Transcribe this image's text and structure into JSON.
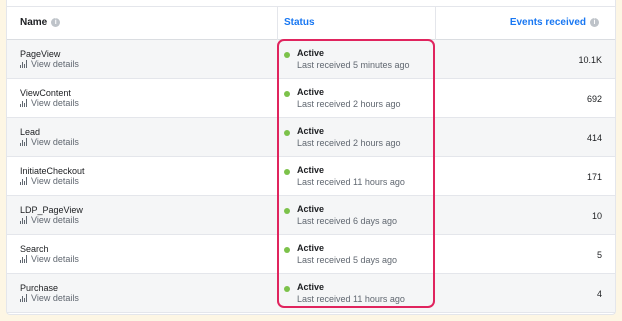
{
  "header": {
    "name_label": "Name",
    "status_label": "Status",
    "events_label": "Events received"
  },
  "rows": [
    {
      "name": "PageView",
      "details": "View details",
      "status": "Active",
      "last": "Last received 5 minutes ago",
      "count": "10.1K"
    },
    {
      "name": "ViewContent",
      "details": "View details",
      "status": "Active",
      "last": "Last received 2 hours ago",
      "count": "692"
    },
    {
      "name": "Lead",
      "details": "View details",
      "status": "Active",
      "last": "Last received 2 hours ago",
      "count": "414"
    },
    {
      "name": "InitiateCheckout",
      "details": "View details",
      "status": "Active",
      "last": "Last received 11 hours ago",
      "count": "171"
    },
    {
      "name": "LDP_PageView",
      "details": "View details",
      "status": "Active",
      "last": "Last received 6 days ago",
      "count": "10"
    },
    {
      "name": "Search",
      "details": "View details",
      "status": "Active",
      "last": "Last received 5 days ago",
      "count": "5"
    },
    {
      "name": "Purchase",
      "details": "View details",
      "status": "Active",
      "last": "Last received 11 hours ago",
      "count": "4"
    }
  ],
  "colors": {
    "accent": "#1877f2",
    "active_dot": "#7cc24a",
    "highlight": "#e0245e",
    "background": "#fdf6e4"
  },
  "icons": {
    "info": "info-circle-icon",
    "details": "bar-chart-icon",
    "status": "status-dot-icon"
  }
}
